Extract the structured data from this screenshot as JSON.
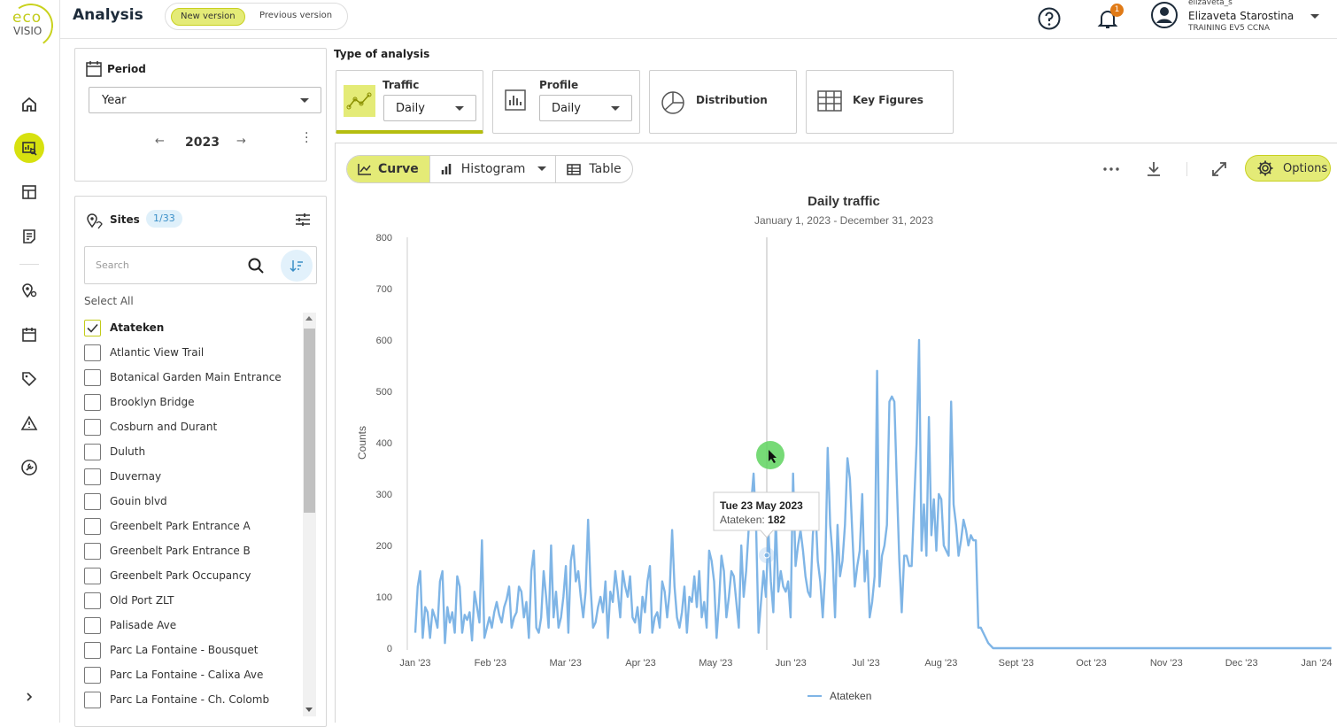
{
  "app": {
    "logo_top": "eco",
    "logo_bottom": "VISIO",
    "page_title": "Analysis",
    "version_new": "New version",
    "version_previous": "Previous version"
  },
  "user": {
    "handle": "elizaveta_s",
    "name": "Elizaveta Starostina",
    "org": "TRAINING EV5 CCNA",
    "notifications": "1"
  },
  "nav": {
    "icons": [
      "home-icon",
      "analysis-icon",
      "dashboard-icon",
      "report-icon",
      "sites-map-icon",
      "calendar-icon",
      "tag-icon",
      "alert-icon",
      "tools-icon",
      "expand-chevron-icon"
    ]
  },
  "period": {
    "title": "Period",
    "granularity": "Year",
    "year": "2023"
  },
  "sites": {
    "title": "Sites",
    "badge": "1/33",
    "search_placeholder": "Search",
    "select_all": "Select All",
    "items": [
      {
        "name": "Atateken",
        "checked": true
      },
      {
        "name": "Atlantic View Trail",
        "checked": false
      },
      {
        "name": "Botanical Garden Main Entrance",
        "checked": false
      },
      {
        "name": "Brooklyn Bridge",
        "checked": false
      },
      {
        "name": "Cosburn and Durant",
        "checked": false
      },
      {
        "name": "Duluth",
        "checked": false
      },
      {
        "name": "Duvernay",
        "checked": false
      },
      {
        "name": "Gouin blvd",
        "checked": false
      },
      {
        "name": "Greenbelt Park Entrance A",
        "checked": false
      },
      {
        "name": "Greenbelt Park Entrance B",
        "checked": false
      },
      {
        "name": "Greenbelt Park Occupancy",
        "checked": false
      },
      {
        "name": "Old Port ZLT",
        "checked": false
      },
      {
        "name": "Palisade Ave",
        "checked": false
      },
      {
        "name": "Parc La Fontaine - Bousquet",
        "checked": false
      },
      {
        "name": "Parc La Fontaine - Calixa Ave",
        "checked": false
      },
      {
        "name": "Parc La Fontaine - Ch. Colomb",
        "checked": false
      }
    ]
  },
  "analysis_types": {
    "label": "Type of analysis",
    "traffic": {
      "name": "Traffic",
      "value": "Daily"
    },
    "profile": {
      "name": "Profile",
      "value": "Daily"
    },
    "distribution": {
      "name": "Distribution"
    },
    "key_figures": {
      "name": "Key Figures"
    }
  },
  "view": {
    "curve": "Curve",
    "histogram": "Histogram",
    "table": "Table",
    "options": "Options"
  },
  "tooltip": {
    "date": "Tue 23 May 2023",
    "series": "Atateken: ",
    "value": "182"
  },
  "colors": {
    "accent": "#d7e10f",
    "series": "#7fb5e6",
    "cursor_green": "#5fd35f"
  },
  "chart_data": {
    "type": "line",
    "title": "Daily traffic",
    "subtitle": "January 1, 2023 - December 31, 2023",
    "ylabel": "Counts",
    "xlabel": "",
    "ylim": [
      0,
      800
    ],
    "yticks": [
      "0",
      "100",
      "200",
      "300",
      "400",
      "500",
      "600",
      "700",
      "800"
    ],
    "xtick_labels": [
      "Jan '23",
      "Feb '23",
      "Mar '23",
      "Apr '23",
      "May '23",
      "Jun '23",
      "Jul '23",
      "Aug '23",
      "Sept '23",
      "Oct '23",
      "Nov '23",
      "Dec '23",
      "Jan '24"
    ],
    "legend": "bottom-center",
    "grid": false,
    "series": [
      {
        "name": "Atateken",
        "x_start": "2023-01-01",
        "values": [
          30,
          120,
          150,
          20,
          80,
          70,
          20,
          75,
          60,
          40,
          130,
          150,
          10,
          80,
          50,
          70,
          30,
          140,
          120,
          30,
          65,
          55,
          70,
          15,
          110,
          80,
          50,
          210,
          20,
          40,
          60,
          40,
          70,
          90,
          65,
          50,
          80,
          95,
          120,
          40,
          60,
          70,
          120,
          110,
          60,
          90,
          20,
          150,
          190,
          40,
          30,
          60,
          150,
          100,
          40,
          200,
          60,
          110,
          40,
          60,
          100,
          160,
          30,
          170,
          200,
          130,
          150,
          100,
          60,
          110,
          250,
          120,
          40,
          50,
          80,
          100,
          70,
          130,
          20,
          110,
          90,
          150,
          110,
          60,
          150,
          120,
          100,
          140,
          60,
          50,
          80,
          30,
          100,
          70,
          130,
          160,
          30,
          60,
          70,
          40,
          130,
          110,
          60,
          110,
          230,
          120,
          60,
          40,
          70,
          120,
          30,
          100,
          90,
          140,
          80,
          150,
          60,
          90,
          40,
          190,
          170,
          130,
          20,
          90,
          180,
          150,
          60,
          100,
          150,
          140,
          90,
          40,
          200,
          100,
          150,
          230,
          280,
          340,
          240,
          30,
          90,
          150,
          100,
          230,
          130,
          70,
          250,
          110,
          150,
          120,
          110,
          130,
          60,
          340,
          160,
          200,
          230,
          190,
          140,
          110,
          100,
          220,
          280,
          170,
          130,
          60,
          150,
          390,
          240,
          180,
          60,
          240,
          140,
          170,
          240,
          370,
          330,
          220,
          120,
          160,
          190,
          300,
          130,
          190,
          60,
          90,
          140,
          540,
          120,
          180,
          200,
          240,
          480,
          490,
          480,
          320,
          170,
          70,
          180,
          180,
          160,
          160,
          280,
          400,
          600,
          190,
          280,
          180,
          450,
          220,
          290,
          190,
          300,
          290,
          200,
          190,
          180,
          480,
          280,
          240,
          180,
          210,
          250,
          230,
          200,
          220,
          210,
          210,
          40,
          40,
          30,
          20,
          10,
          5,
          0,
          0,
          0,
          0,
          0,
          0,
          0,
          0,
          0,
          0,
          0,
          0,
          0,
          0,
          0,
          0,
          0,
          0,
          0,
          0,
          0,
          0,
          0,
          0,
          0,
          0,
          0,
          0,
          0,
          0,
          0,
          0,
          0,
          0,
          0,
          0,
          0,
          0,
          0,
          0,
          0,
          0,
          0,
          0,
          0,
          0,
          0,
          0,
          0,
          0,
          0,
          0,
          0,
          0,
          0,
          0,
          0,
          0,
          0,
          0,
          0,
          0,
          0,
          0,
          0,
          0,
          0,
          0,
          0,
          0,
          0,
          0,
          0,
          0,
          0,
          0,
          0,
          0,
          0,
          0,
          0,
          0,
          0,
          0,
          0,
          0,
          0,
          0,
          0,
          0,
          0,
          0,
          0,
          0,
          0,
          0,
          0,
          0,
          0,
          0,
          0,
          0,
          0,
          0,
          0,
          0,
          0,
          0,
          0,
          0,
          0,
          0,
          0,
          0,
          0,
          0,
          0,
          0,
          0,
          0,
          0,
          0,
          0,
          0,
          0,
          0,
          0,
          0,
          0,
          0,
          0,
          0,
          0,
          0,
          0,
          0,
          0,
          0
        ]
      }
    ]
  }
}
